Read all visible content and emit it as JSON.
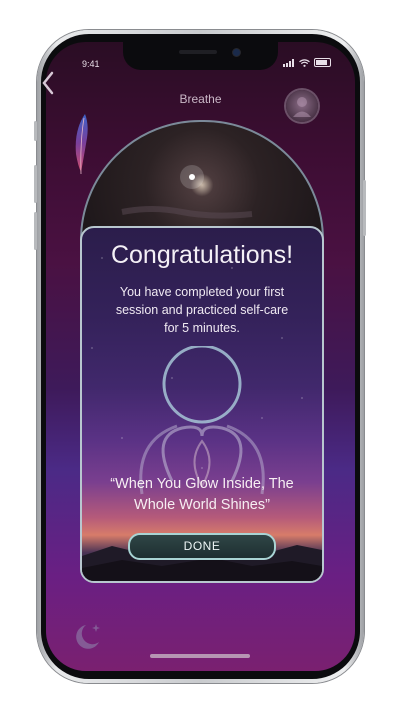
{
  "status_bar": {
    "time": "9:41"
  },
  "header": {
    "title": "Breathe"
  },
  "dialog": {
    "title": "Congratulations!",
    "message_lines": [
      "You have completed your first",
      "session and practiced self-care",
      "for 5 minutes."
    ],
    "quote_lines": [
      "“When You Glow Inside, The",
      "Whole World Shines”"
    ],
    "done_label": "DONE"
  },
  "icons": {
    "back": "chevron-left-icon",
    "avatar": "avatar-icon",
    "feather": "feather-icon",
    "self_care": "person-heart-icon",
    "moon": "moon-stars-icon"
  },
  "colors": {
    "accent_border": "#b8c7cf",
    "button_border": "#a9d4d4"
  }
}
